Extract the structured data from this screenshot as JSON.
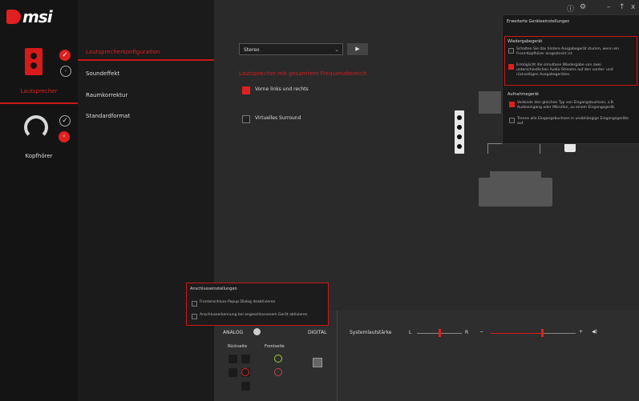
{
  "brand": {
    "logo_text": "msi"
  },
  "window_controls": {
    "info": "ⓘ",
    "settings": "⚙",
    "minimize": "–",
    "maximize": "↑",
    "close": "x"
  },
  "devices": [
    {
      "label": "Lautsprecher",
      "state": "active"
    },
    {
      "label": "Kopfhörer",
      "state": "inactive"
    }
  ],
  "subnav": {
    "items": [
      "Lautsprecherkonfiguration",
      "Soundeffekt",
      "Raumkorrektur",
      "Standardformat"
    ],
    "active_index": 0
  },
  "speaker_config": {
    "mode_select": {
      "value": "Stereo"
    },
    "test_button": "▶",
    "fullrange_heading": "Lautsprecher mit gesamtem Frequenzbereich",
    "options": [
      {
        "label": "Vorne links und rechts",
        "checked": true
      },
      {
        "label": "Virtuelles Surround",
        "checked": false
      }
    ]
  },
  "advanced_panel": {
    "title": "Erweiterte Geräteeinstellungen",
    "playback": {
      "heading": "Wiedergabegerät",
      "options": [
        {
          "text": "Schalten Sie das hintere Ausgabegerät stumm, wenn ein Front-Kopfhörer eingesteckt ist.",
          "checked": false
        },
        {
          "text": "Ermöglicht die simultane Wiedergabe von zwei unterschiedlichen Audio-Streams auf den vorder- und rückseitigen Ausgabegeräten.",
          "checked": true
        }
      ]
    },
    "recording": {
      "heading": "Aufnahmegerät",
      "options": [
        {
          "text": "Verbinde den gleichen Typ von Eingangsbuchsen, z.B. Audioeingang oder Mikrofon, zu einem Eingangsgerät.",
          "checked": true
        },
        {
          "text": "Trenne alle Eingangsbuchsen in unabhängige Eingangsgeräte auf.",
          "checked": false
        }
      ]
    }
  },
  "connector_panel": {
    "title": "Anschlusseinstellungen",
    "options": [
      {
        "text": "Frontanschluss-Popup-Dialog deaktivieren",
        "checked": false
      },
      {
        "text": "Anschlusserkennung bei angeschlossenem Gerät aktivieren",
        "checked": false
      }
    ]
  },
  "jacks": {
    "analog_label": "ANALOG",
    "digital_label": "DIGITAL",
    "rear_label": "Rückseite",
    "front_label": "Frontseite",
    "colors": {
      "active_red": "#e02020",
      "green": "#9acd32",
      "pink": "#c04050"
    }
  },
  "volume": {
    "label": "Systemlautstärke",
    "balance_left": "L",
    "balance_right": "R",
    "minus": "−",
    "plus": "+",
    "speaker_icon": "◀)",
    "balance": 0.5,
    "level": 0.6
  },
  "colors": {
    "accent": "#e02020",
    "bg": "#2c2c2c",
    "sidebar": "#141414"
  }
}
